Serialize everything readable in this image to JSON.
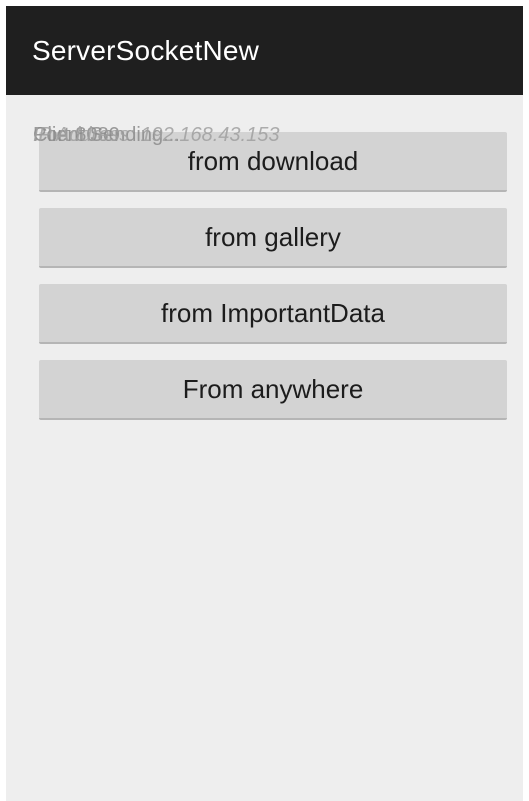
{
  "app": {
    "title": "ServerSocketNew"
  },
  "status": {
    "lines": [
      "Client Sending...",
      "Port 8080",
      "IP Address: 192.168.43.153"
    ]
  },
  "buttons": [
    {
      "label": "from download"
    },
    {
      "label": "from gallery"
    },
    {
      "label": "from ImportantData"
    },
    {
      "label": "From anywhere"
    }
  ],
  "colors": {
    "action_bar": "#1f1f1f",
    "background": "#eeeeee",
    "button": "#d3d3d3",
    "title_text": "#ffffff"
  }
}
